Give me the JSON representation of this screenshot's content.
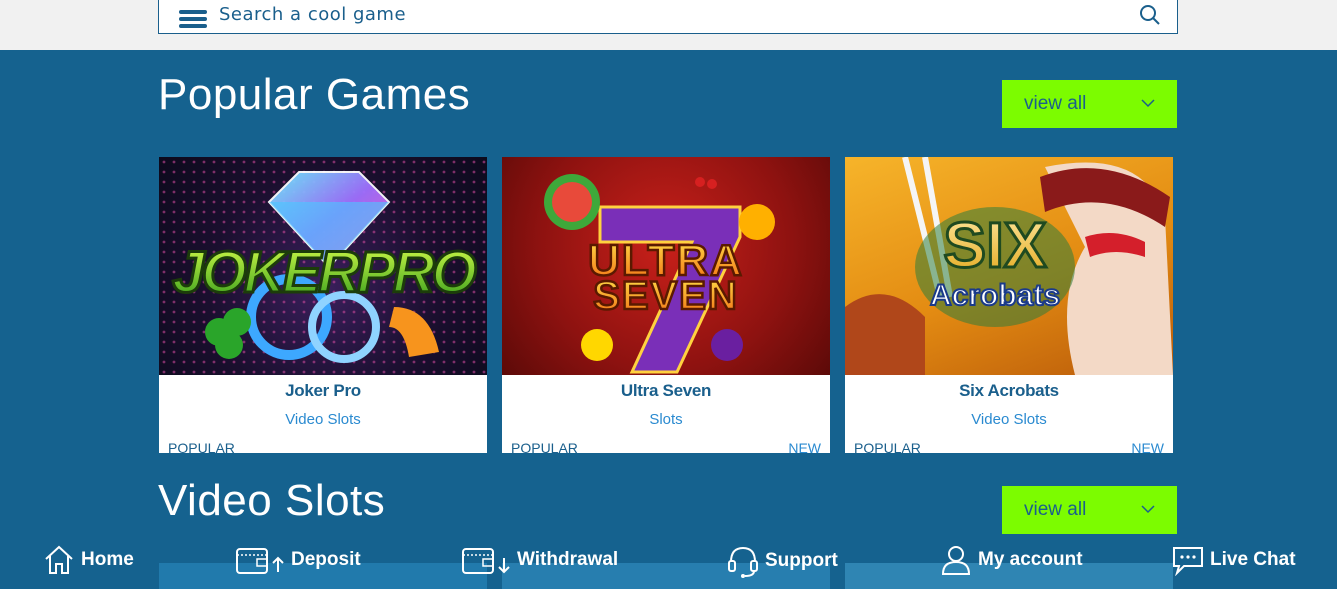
{
  "search": {
    "placeholder": "Search a cool game"
  },
  "sections": [
    {
      "title": "Popular Games",
      "view_all": "view all"
    },
    {
      "title": "Video Slots",
      "view_all": "view all"
    }
  ],
  "games": [
    {
      "name": "Joker Pro",
      "category": "Video Slots",
      "tag_left": "POPULAR",
      "tag_right": "",
      "art_text": "JOKERPRO"
    },
    {
      "name": "Ultra Seven",
      "category": "Slots",
      "tag_left": "POPULAR",
      "tag_right": "NEW",
      "art_text_1": "ULTRA",
      "art_text_2": "SEVEN"
    },
    {
      "name": "Six Acrobats",
      "category": "Video Slots",
      "tag_left": "POPULAR",
      "tag_right": "NEW",
      "art_text_1": "SIX",
      "art_text_2": "Acrobats"
    }
  ],
  "nav": [
    {
      "label": "Home",
      "icon": "home-icon"
    },
    {
      "label": "Deposit",
      "icon": "wallet-up-icon"
    },
    {
      "label": "Withdrawal",
      "icon": "wallet-down-icon"
    },
    {
      "label": "Support",
      "icon": "headset-icon"
    },
    {
      "label": "My account",
      "icon": "user-icon"
    },
    {
      "label": "Live Chat",
      "icon": "chat-icon"
    }
  ],
  "colors": {
    "background": "#15628f",
    "accent": "#7cfc00",
    "text_dark": "#1a5f8c",
    "text_link": "#2a8ad0"
  }
}
